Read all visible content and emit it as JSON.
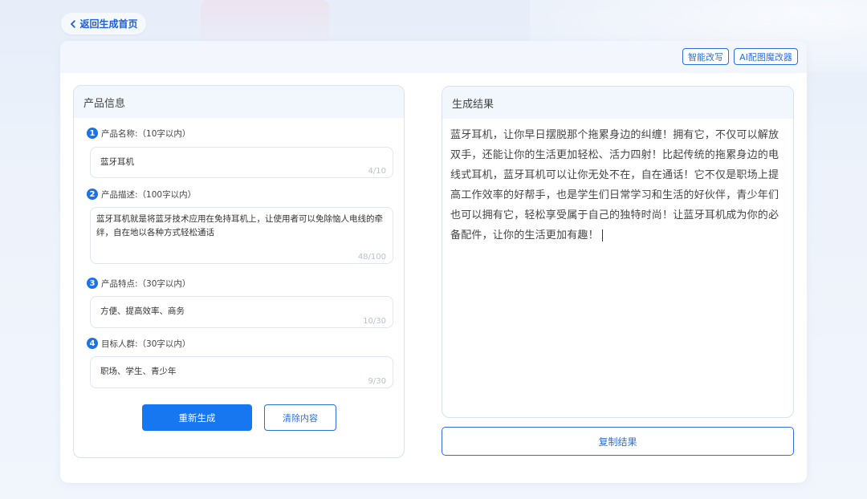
{
  "nav": {
    "back_label": "返回生成首页"
  },
  "toolbar": {
    "smart_rewrite": "智能改写",
    "ai_image": "AI配图魔改器"
  },
  "left_panel": {
    "title": "产品信息",
    "fields": [
      {
        "num": "1",
        "label": "产品名称:（10字以内）",
        "value": "蓝牙耳机",
        "counter": "4/10"
      },
      {
        "num": "2",
        "label": "产品描述:（100字以内）",
        "value": "蓝牙耳机就是将蓝牙技术应用在免持耳机上，让使用者可以免除恼人电线的牵绊，自在地以各种方式轻松通话",
        "counter": "48/100"
      },
      {
        "num": "3",
        "label": "产品特点:（30字以内）",
        "value": "方便、提高效率、商务",
        "counter": "10/30"
      },
      {
        "num": "4",
        "label": "目标人群:（30字以内）",
        "value": "职场、学生、青少年",
        "counter": "9/30"
      }
    ],
    "regenerate_label": "重新生成",
    "clear_label": "清除内容"
  },
  "right_panel": {
    "title": "生成结果",
    "result": "蓝牙耳机，让你早日摆脱那个拖累身边的纠缠！拥有它，不仅可以解放双手，还能让你的生活更加轻松、活力四射！比起传统的拖累身边的电线式耳机，蓝牙耳机可以让你无处不在，自在通话！它不仅是职场上提高工作效率的好帮手，也是学生们日常学习和生活的好伙伴，青少年们也可以拥有它，轻松享受属于自己的独特时尚！让蓝牙耳机成为你的必备配件，让你的生活更加有趣！",
    "copy_label": "复制结果"
  },
  "colors": {
    "primary": "#1677f0",
    "accent": "#2c6fe0"
  },
  "icons": {
    "back": "chevron-left-icon"
  }
}
